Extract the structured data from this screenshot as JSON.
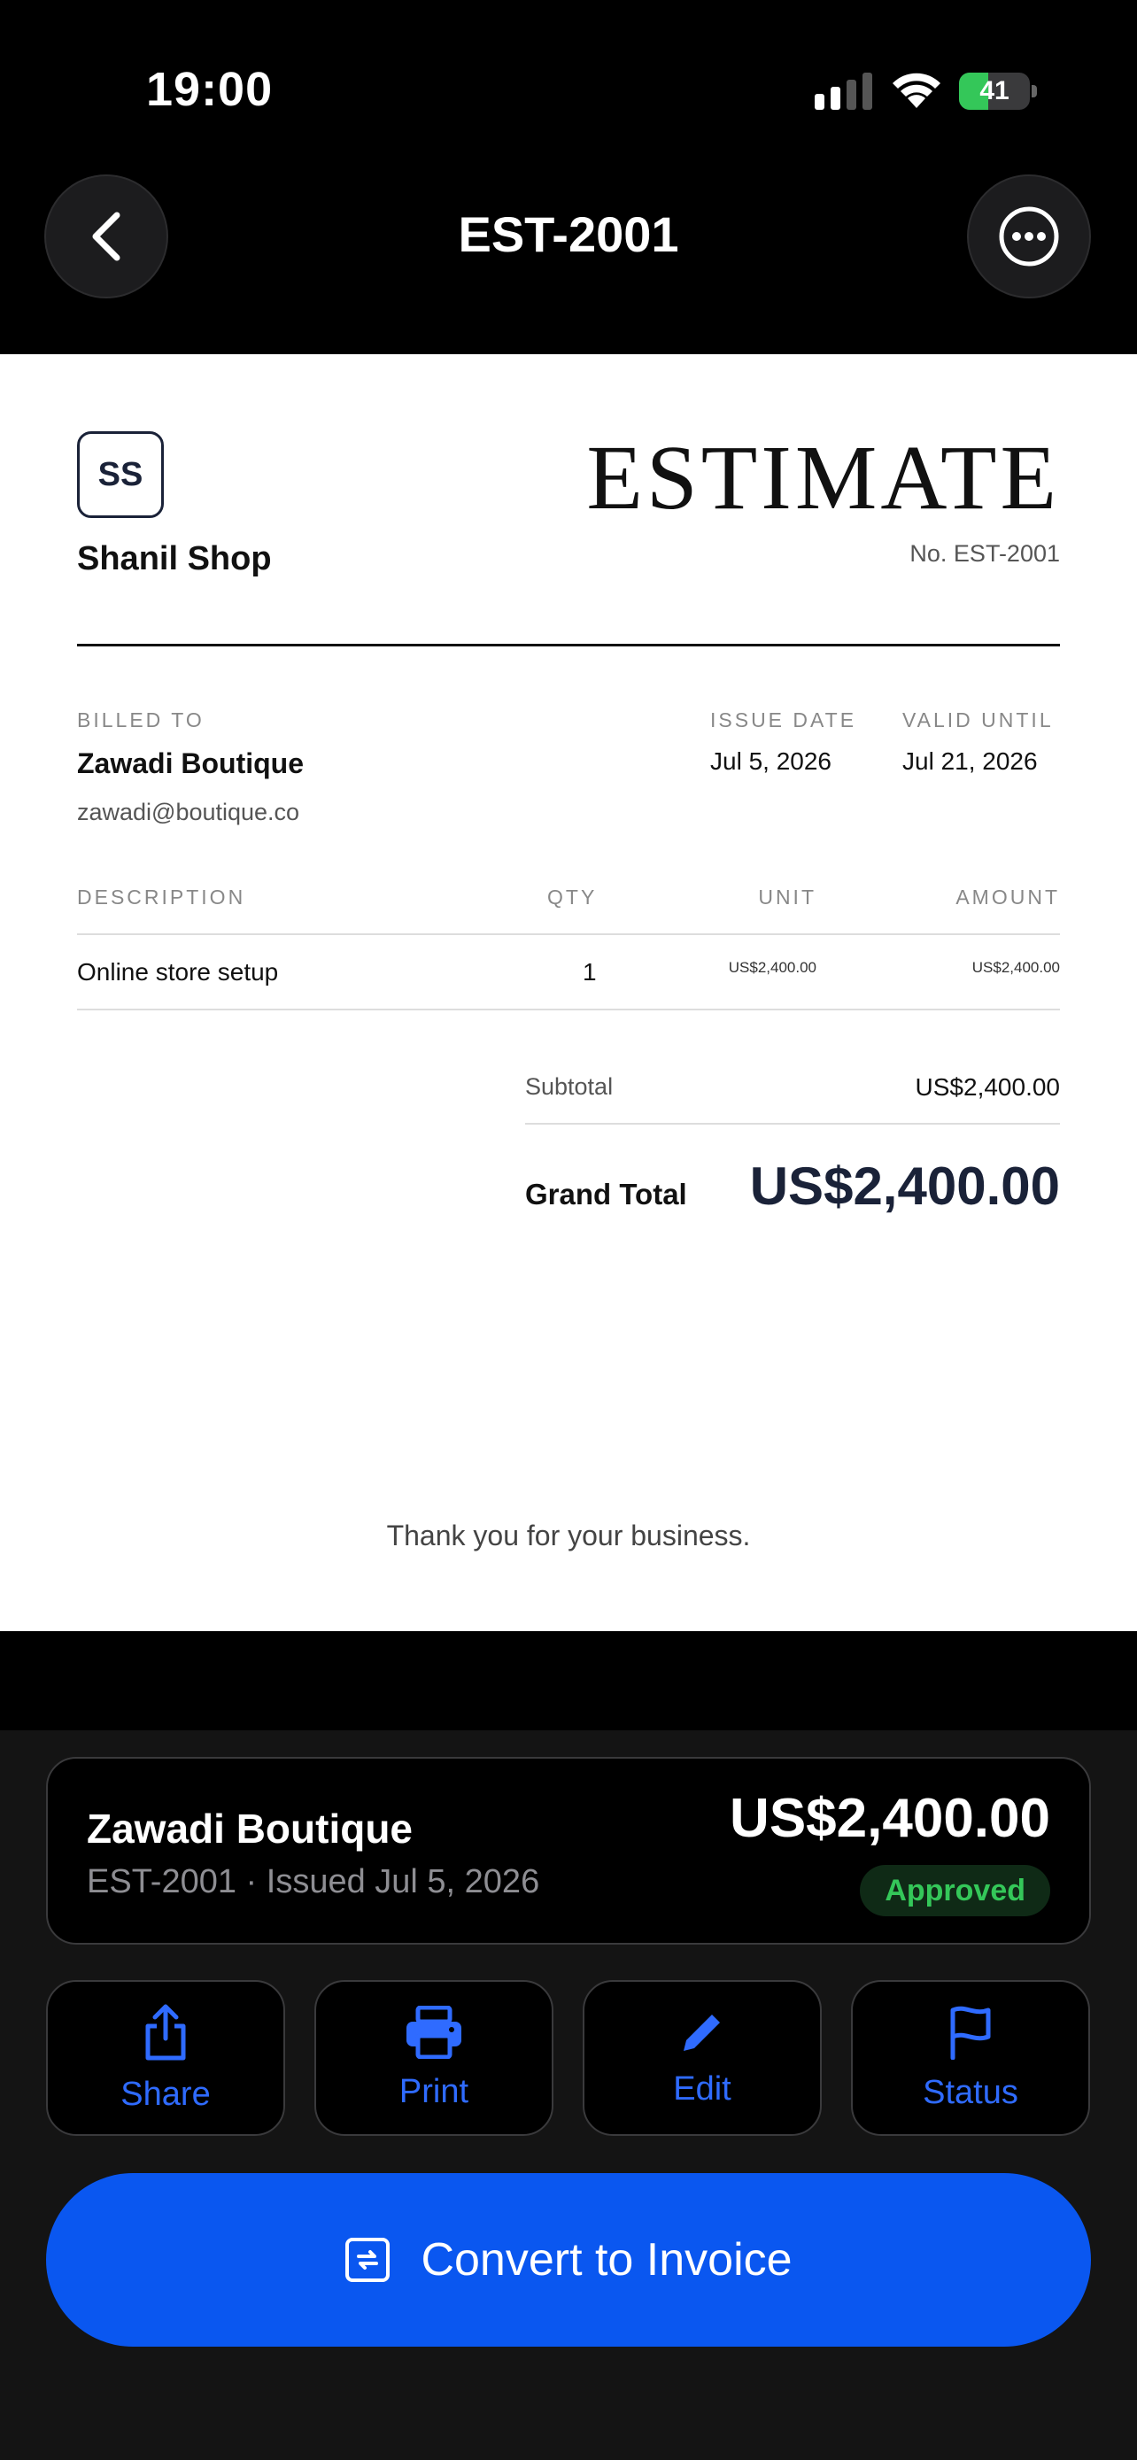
{
  "status_bar": {
    "time": "19:00",
    "battery_percent": "41",
    "battery_level": 0.41
  },
  "nav": {
    "title": "EST-2001"
  },
  "document": {
    "logo_initials": "SS",
    "shop_name": "Shanil Shop",
    "title": "ESTIMATE",
    "number": "No. EST-2001",
    "billed_to_label": "BILLED TO",
    "client_name": "Zawadi Boutique",
    "client_email": "zawadi@boutique.co",
    "issue_date_label": "ISSUE DATE",
    "issue_date": "Jul 5, 2026",
    "valid_until_label": "VALID UNTIL",
    "valid_until": "Jul 21, 2026",
    "columns": {
      "description": "DESCRIPTION",
      "qty": "QTY",
      "unit": "UNIT",
      "amount": "AMOUNT"
    },
    "items": [
      {
        "description": "Online store setup",
        "qty": "1",
        "unit": "US$2,400.00",
        "amount": "US$2,400.00"
      }
    ],
    "subtotal_label": "Subtotal",
    "subtotal": "US$2,400.00",
    "grand_total_label": "Grand Total",
    "grand_total": "US$2,400.00",
    "footer_note": "Thank you for your business."
  },
  "summary": {
    "client": "Zawadi Boutique",
    "meta": "EST-2001 · Issued Jul 5, 2026",
    "amount": "US$2,400.00",
    "status": "Approved"
  },
  "actions": {
    "share": "Share",
    "print": "Print",
    "edit": "Edit",
    "status": "Status"
  },
  "convert_button": "Convert to Invoice",
  "colors": {
    "accent": "#0a57f0",
    "status_green": "#34c759",
    "navy": "#1a2238"
  }
}
